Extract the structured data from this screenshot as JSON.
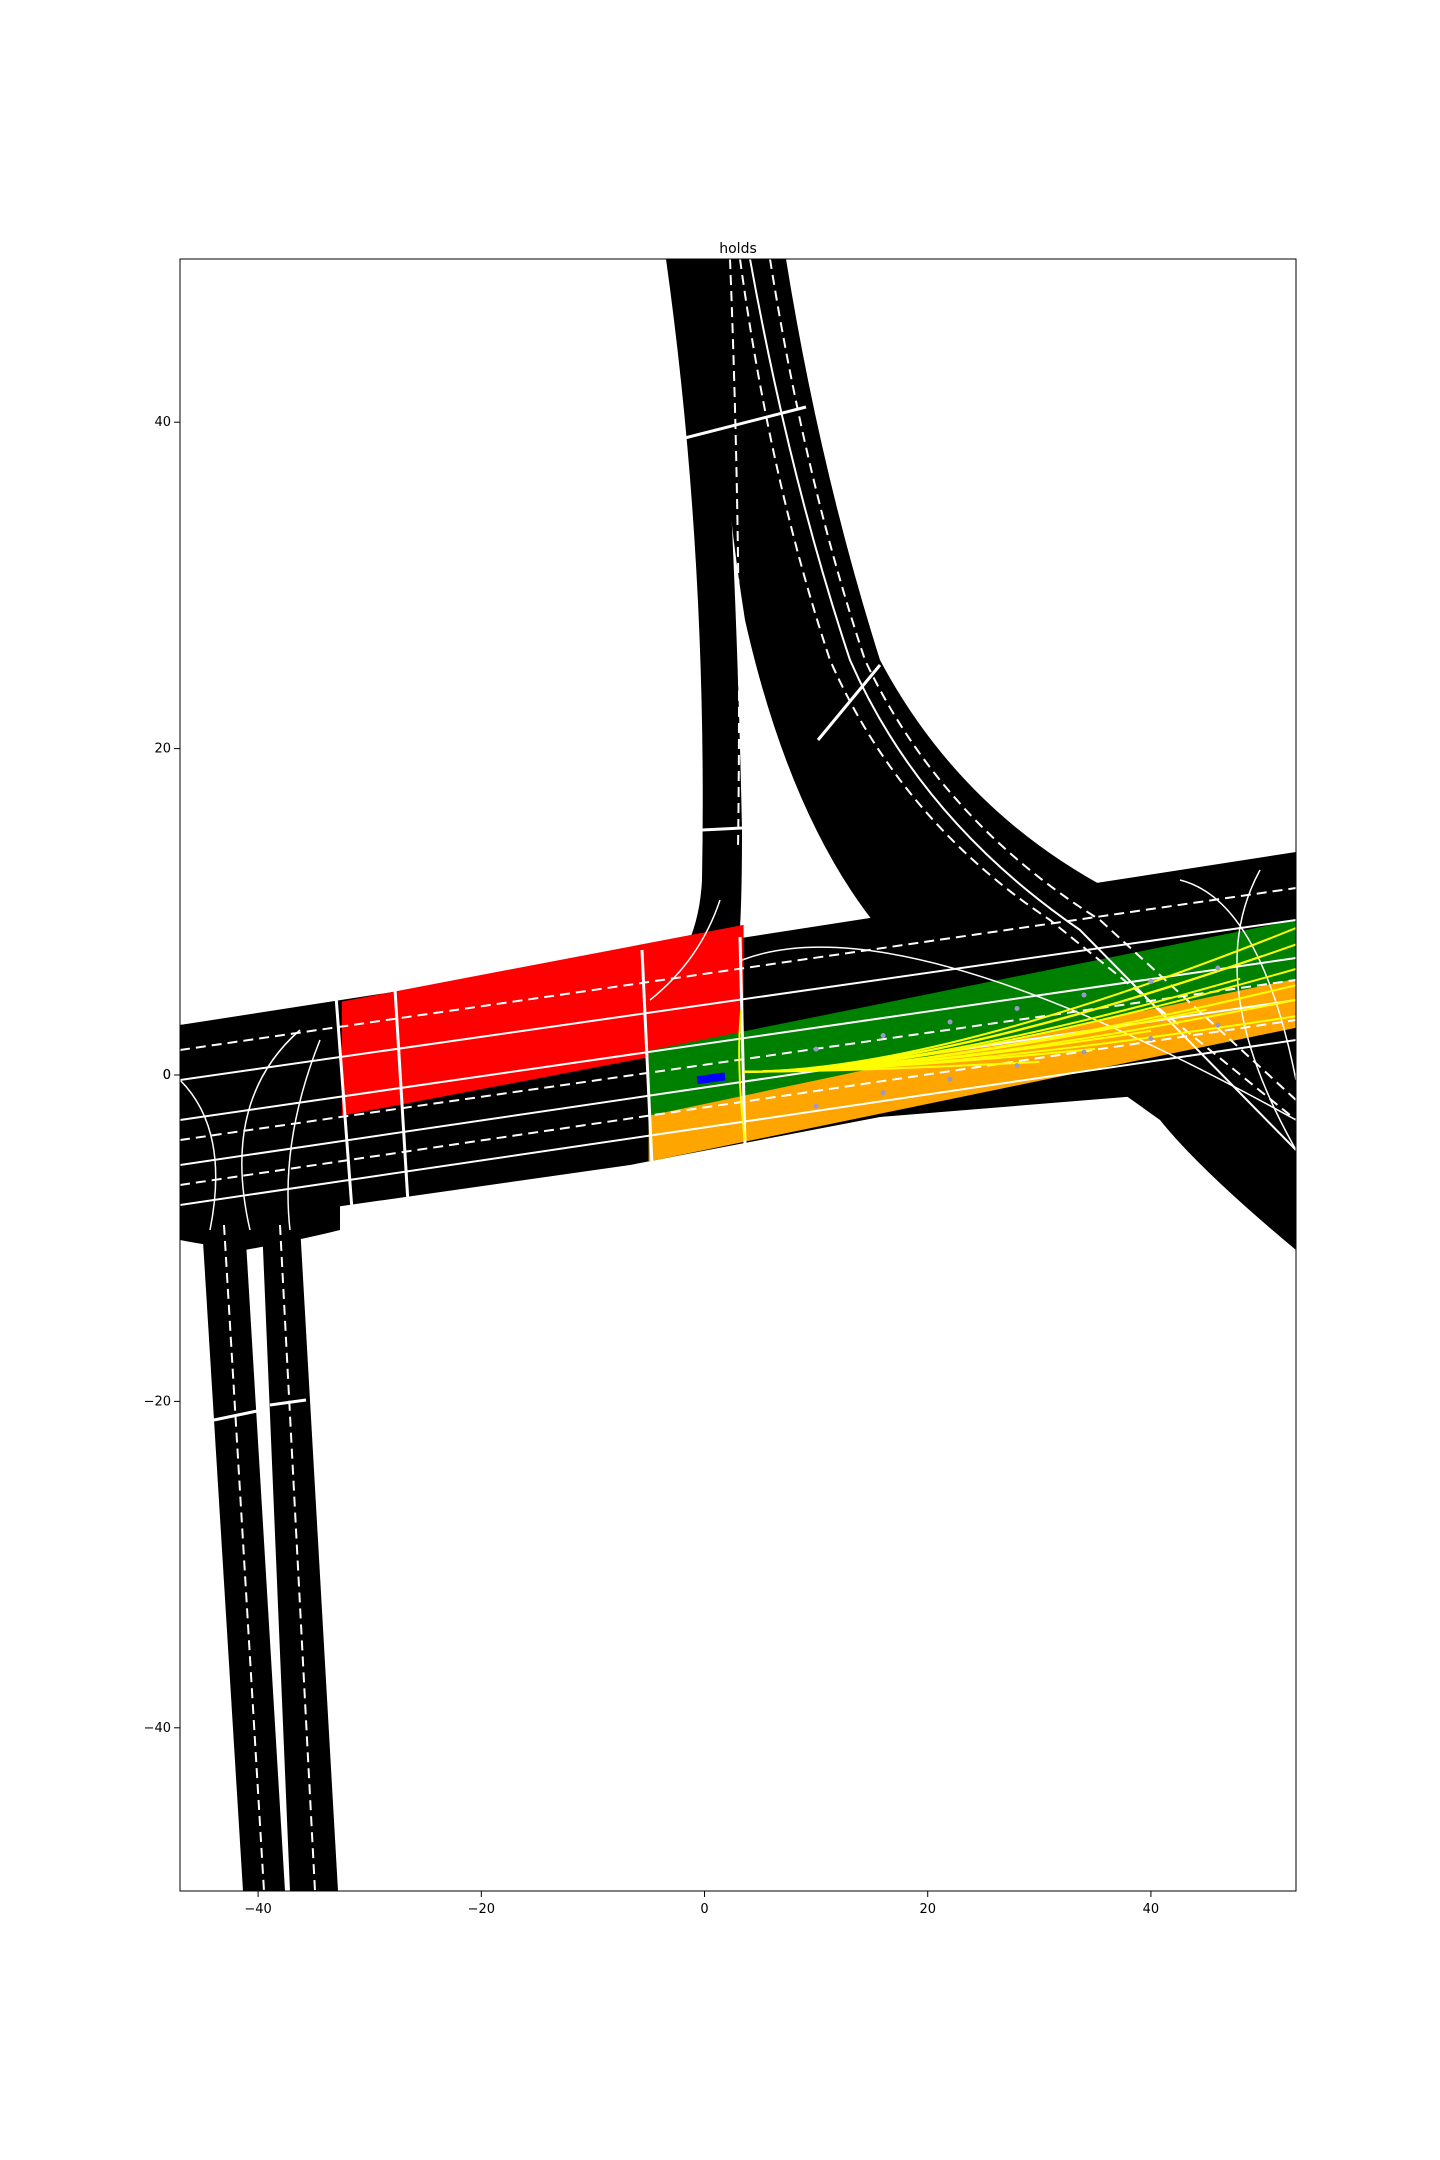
{
  "chart_data": {
    "type": "map",
    "title": "holds",
    "xlim": [
      -47,
      53
    ],
    "ylim": [
      -50,
      50
    ],
    "xticks": [
      -40,
      -20,
      0,
      20,
      40
    ],
    "yticks": [
      -40,
      -20,
      0,
      20,
      40
    ],
    "xtick_labels": [
      "−40",
      "−20",
      "0",
      "20",
      "40"
    ],
    "ytick_labels": [
      "−40",
      "−20",
      "0",
      "20",
      "40"
    ],
    "grid": false,
    "colors": {
      "road": "#000000",
      "lane_line": "#ffffff",
      "region_red": "#ff0000",
      "region_green": "#008000",
      "region_orange": "#ffa500",
      "trajectories": "#ffff00",
      "ego_vehicle": "#0000ff",
      "waypoints": "#9999cc"
    },
    "regions": [
      {
        "name": "red",
        "polygon": [
          [
            -32.5,
            4.5
          ],
          [
            3.5,
            9.2
          ],
          [
            3.5,
            2.2
          ],
          [
            -32.5,
            -2.5
          ]
        ]
      },
      {
        "name": "green",
        "polygon": [
          [
            -5,
            1.5
          ],
          [
            53,
            9.5
          ],
          [
            53,
            2.9
          ],
          [
            -5,
            -5.3
          ]
        ]
      },
      {
        "name": "orange",
        "polygon": [
          [
            -5,
            -2.5
          ],
          [
            53,
            5.9
          ],
          [
            53,
            2.9
          ],
          [
            -5,
            -5.3
          ]
        ]
      }
    ],
    "ego_vehicle": {
      "x": 0.6,
      "y": -0.2,
      "heading_deg": 8
    },
    "trajectory_origin": [
      3.5,
      0.2
    ],
    "trajectory_endpoints": [
      [
        53,
        9.0
      ],
      [
        53,
        8.0
      ],
      [
        50,
        7.3
      ],
      [
        53,
        6.5
      ],
      [
        53,
        5.5
      ],
      [
        53,
        4.6
      ],
      [
        48,
        5.9
      ],
      [
        45,
        4.0
      ],
      [
        53,
        3.6
      ],
      [
        40,
        2.7
      ],
      [
        35,
        1.6
      ],
      [
        30,
        0.8
      ]
    ]
  }
}
